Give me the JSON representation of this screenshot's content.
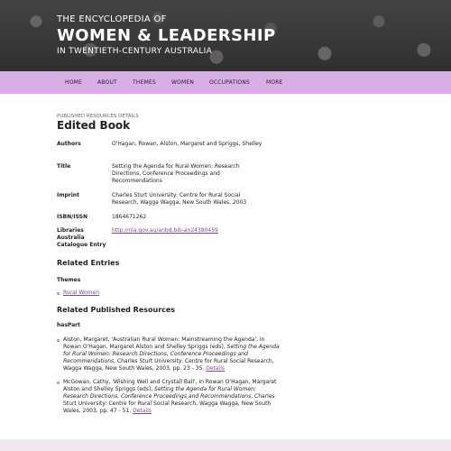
{
  "header": {
    "line1": "THE ENCYCLOPEDIA OF",
    "line2": "WOMEN & LEADERSHIP",
    "line3": "IN TWENTIETH-CENTURY AUSTRALIA"
  },
  "nav": [
    "HOME",
    "ABOUT",
    "THEMES",
    "WOMEN",
    "OCCUPATIONS",
    "MORE"
  ],
  "breadcrumb": "PUBLISHED RESOURCES DETAILS",
  "page_title": "Edited Book",
  "fields": {
    "authors_label": "Authors",
    "authors_value": "O'Hagan, Rowan, Alston, Margaret and Spriggs, Shelley",
    "title_label": "Title",
    "title_value": "Setting the Agenda for Rural Women: Research Directions, Conference Proceedings and Recommendations",
    "imprint_label": "Imprint",
    "imprint_value": "Charles Sturt University: Centre for Rural Social Research, Wagga Wagga, New South Wales, 2003",
    "isbn_label": "ISBN/ISSN",
    "isbn_value": "1864671262",
    "libraries_label": "Libraries Australia Catalogue Entry",
    "libraries_value": "http://nla.gov.au/anbd.bib-an24380459"
  },
  "related_entries": {
    "heading": "Related Entries",
    "themes_heading": "Themes",
    "themes": [
      "Rural Women"
    ]
  },
  "related_published": {
    "heading": "Related Published Resources",
    "subheading": "hasPart",
    "items": [
      {
        "text": "Alston, Margaret, 'Australian Rural Women: Mainstreaming the Agenda', in Rowan O'Hagan, Margaret Alston and Shelley Spriggs (eds), ",
        "italic": "Setting the Agenda for Rural Women: Research Directions, Conference Proceedings and Recommendations",
        "rest": ", Charles Sturt University: Centre for Rural Social Research, Wagga Wagga, New South Wales, 2003, pp. 23 - 35. ",
        "link": "Details"
      },
      {
        "text": "McGowan, Cathy, 'Wishing Well and Crystall Ball', in Rowan O'Hagan, Margaret Alston and Shelley Spriggs (eds), ",
        "italic": "Setting the Agenda for Rural Women: Research Directions, Conference Proceedings and Recommendations",
        "rest": ", Charles Sturt University: Centre for Rural Social Research, Wagga Wagga, New South Wales, 2003, pp. 47 - 51. ",
        "link": "Details"
      }
    ]
  }
}
